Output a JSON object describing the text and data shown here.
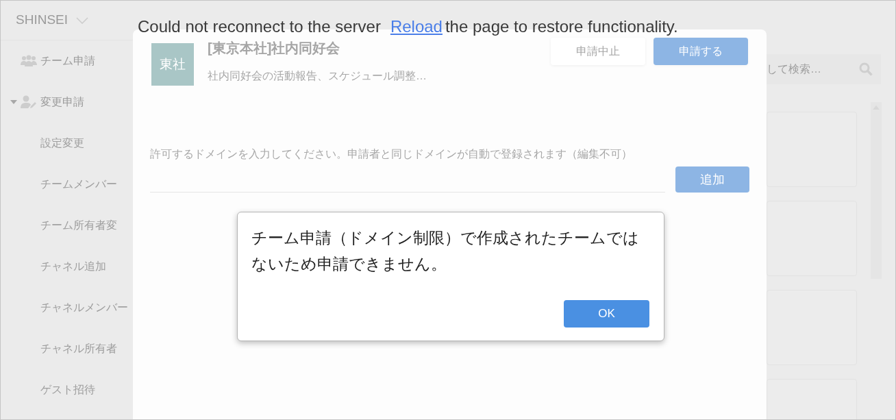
{
  "banner": {
    "before": "Could not reconnect to the server",
    "link": "Reload",
    "after": "the page to restore functionality."
  },
  "sidebar": {
    "brand": "SHINSEI",
    "items": [
      {
        "label": "チーム申請",
        "kind": "team"
      },
      {
        "label": "変更申請",
        "kind": "group",
        "expanded": true,
        "children": [
          {
            "label": "設定変更"
          },
          {
            "label": "チームメンバー"
          },
          {
            "label": "チーム所有者変"
          },
          {
            "label": "チャネル追加"
          },
          {
            "label": "チャネルメンバー"
          },
          {
            "label": "チャネル所有者"
          },
          {
            "label": "ゲスト招待"
          }
        ]
      }
    ]
  },
  "search": {
    "placeholder": "して検索…"
  },
  "modal": {
    "team": {
      "avatar": "東社",
      "name": "[東京本社]社内同好会",
      "description": "社内同好会の活動報告、スケジュール調整…"
    },
    "buttons": [
      {
        "label": "申請中止",
        "kind": "secondary"
      },
      {
        "label": "申請する",
        "kind": "primary"
      }
    ],
    "domain": {
      "label": "許可するドメインを入力してください。申請者と同じドメインが自動で登録されます（編集不可）",
      "add_button": "追加"
    }
  },
  "alert": {
    "message": "チーム申請（ドメイン制限）で作成されたチームではないため申請できません。",
    "button": "OK"
  }
}
